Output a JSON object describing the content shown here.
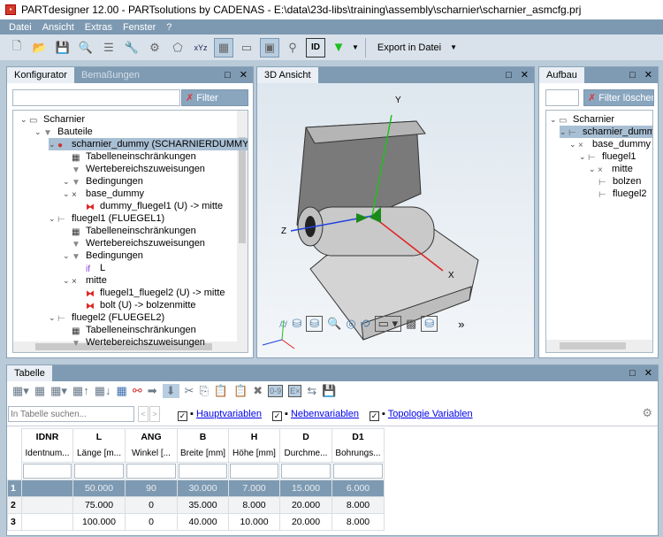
{
  "window": {
    "title": "PARTdesigner 12.00 - PARTsolutions by CADENAS - E:\\data\\23d-libs\\training\\assembly\\scharnier\\scharnier_asmcfg.prj"
  },
  "menu": [
    "Datei",
    "Ansicht",
    "Extras",
    "Fenster",
    "?"
  ],
  "toolbar": {
    "export_label": "Export in Datei"
  },
  "konfigurator": {
    "tabs": [
      "Konfigurator",
      "Bemaßungen"
    ],
    "filter_label": "Filter löschen",
    "tree": [
      {
        "label": "Scharnier",
        "level": 0,
        "icon": "assembly-icon"
      },
      {
        "label": "Bauteile",
        "level": 1,
        "icon": "folder-triangle-icon"
      },
      {
        "label": "scharnier_dummy (SCHARNIERDUMMY)",
        "level": 2,
        "icon": "part-dummy-icon",
        "selected": true
      },
      {
        "label": "Tabelleneinschränkungen",
        "level": 3,
        "icon": "table-icon"
      },
      {
        "label": "Wertebereichszuweisungen",
        "level": 3,
        "icon": "triangle-icon"
      },
      {
        "label": "Bedingungen",
        "level": 3,
        "icon": "triangle-icon"
      },
      {
        "label": "base_dummy",
        "level": 3,
        "icon": "cross-icon"
      },
      {
        "label": "dummy_fluegel1 (U) -> mitte",
        "level": 4,
        "icon": "constraint-icon"
      },
      {
        "label": "fluegel1 (FLUEGEL1)",
        "level": 2,
        "icon": "part-icon"
      },
      {
        "label": "Tabelleneinschränkungen",
        "level": 3,
        "icon": "table-icon"
      },
      {
        "label": "Wertebereichszuweisungen",
        "level": 3,
        "icon": "triangle-icon"
      },
      {
        "label": "Bedingungen",
        "level": 3,
        "icon": "triangle-icon"
      },
      {
        "label": "L",
        "level": 4,
        "icon": "if-icon"
      },
      {
        "label": "mitte",
        "level": 3,
        "icon": "cross-icon"
      },
      {
        "label": "fluegel1_fluegel2 (U) -> mitte",
        "level": 4,
        "icon": "constraint-icon"
      },
      {
        "label": "bolt (U) -> bolzenmitte",
        "level": 4,
        "icon": "constraint-icon"
      },
      {
        "label": "fluegel2 (FLUEGEL2)",
        "level": 2,
        "icon": "part-icon"
      },
      {
        "label": "Tabelleneinschränkungen",
        "level": 3,
        "icon": "table-icon"
      },
      {
        "label": "Wertebereichszuweisungen",
        "level": 3,
        "icon": "triangle-icon"
      }
    ]
  },
  "view3d": {
    "tab": "3D Ansicht",
    "axes": [
      "Y",
      "Z",
      "X"
    ],
    "more": "»"
  },
  "aufbau": {
    "tab": "Aufbau",
    "filter_label": "Filter löschen",
    "tree": [
      {
        "label": "Scharnier",
        "level": 0
      },
      {
        "label": "scharnier_dummy",
        "level": 1,
        "selected": true
      },
      {
        "label": "base_dummy",
        "level": 2
      },
      {
        "label": "fluegel1",
        "level": 3
      },
      {
        "label": "mitte",
        "level": 4
      },
      {
        "label": "bolzen",
        "level": 5
      },
      {
        "label": "fluegel2",
        "level": 5
      }
    ]
  },
  "tabelle": {
    "tab": "Tabelle",
    "search_placeholder": "In Tabelle suchen...",
    "checks": [
      {
        "label": "Hauptvariablen",
        "checked": true
      },
      {
        "label": "Nebenvariablen",
        "checked": true
      },
      {
        "label": "Topologie Variablen",
        "checked": true
      }
    ],
    "columns": [
      {
        "name": "IDNR",
        "desc": "Identnum..."
      },
      {
        "name": "L",
        "desc": "Länge [m..."
      },
      {
        "name": "ANG",
        "desc": "Winkel [..."
      },
      {
        "name": "B",
        "desc": "Breite [mm]"
      },
      {
        "name": "H",
        "desc": "Höhe [mm]"
      },
      {
        "name": "D",
        "desc": "Durchme..."
      },
      {
        "name": "D1",
        "desc": "Bohrungs..."
      }
    ],
    "rows": [
      {
        "num": "1",
        "cells": [
          "",
          "50.000",
          "90",
          "30.000",
          "7.000",
          "15.000",
          "6.000"
        ],
        "selected": true
      },
      {
        "num": "2",
        "cells": [
          "",
          "75.000",
          "0",
          "35.000",
          "8.000",
          "20.000",
          "8.000"
        ]
      },
      {
        "num": "3",
        "cells": [
          "",
          "100.000",
          "0",
          "40.000",
          "10.000",
          "20.000",
          "8.000"
        ]
      }
    ]
  },
  "colors": {
    "accent": "#7f9bb3",
    "selection": "#7e9ab2",
    "x_axis": "#e02020",
    "y_axis": "#20c020",
    "z_axis": "#2040e0"
  }
}
